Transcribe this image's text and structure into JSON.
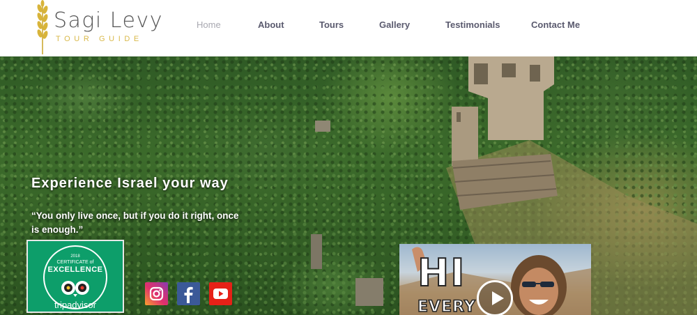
{
  "brand": {
    "name": "Sagi Levy",
    "tagline": "TOUR GUIDE",
    "accent_color": "#d9b94a"
  },
  "nav": {
    "items": [
      {
        "label": "Home",
        "active": true
      },
      {
        "label": "About",
        "active": false
      },
      {
        "label": "Tours",
        "active": false
      },
      {
        "label": "Gallery",
        "active": false
      },
      {
        "label": "Testimonials",
        "active": false
      },
      {
        "label": "Contact Me",
        "active": false
      }
    ]
  },
  "hero": {
    "title": "Experience Israel your way",
    "quote": "“You only live once, but if you do it right, once is enough.”"
  },
  "tripadvisor": {
    "year": "2018",
    "certificate": "CERTIFICATE of",
    "excellence": "EXCELLENCE",
    "brand": "tripadvisor",
    "color": "#0d9e6a"
  },
  "social": [
    {
      "icon": "instagram-icon",
      "color": "#e1306c"
    },
    {
      "icon": "facebook-icon",
      "color": "#3b5998"
    },
    {
      "icon": "youtube-icon",
      "color": "#e62117"
    }
  ],
  "video": {
    "caption_line1": "HI",
    "caption_line2": "EVERY",
    "icon": "play-icon"
  }
}
